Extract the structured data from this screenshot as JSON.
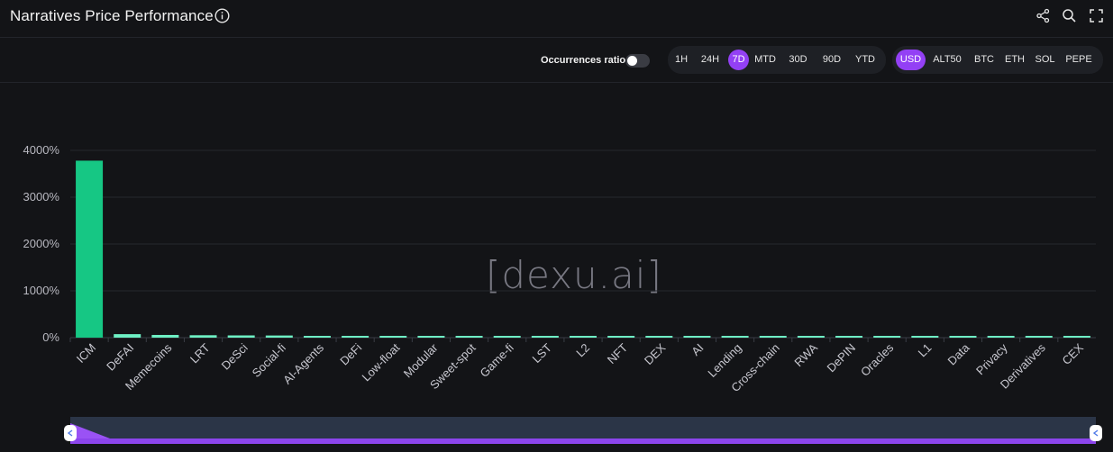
{
  "header": {
    "title": "Narratives Price Performance"
  },
  "controls": {
    "occurrences_label": "Occurrences ratio",
    "occurrences_on": false,
    "timeframes": [
      "1H",
      "24H",
      "7D",
      "MTD",
      "30D",
      "90D",
      "YTD"
    ],
    "active_timeframe": "7D",
    "currencies": [
      "USD",
      "ALT50",
      "BTC",
      "ETH",
      "SOL",
      "PEPE"
    ],
    "active_currency": "USD"
  },
  "watermark": "[dexu.ai]",
  "colors": {
    "accent": "#9340f5",
    "bar_primary": "#16c784",
    "bar_minor": "#6ef0c4",
    "background": "#131417"
  },
  "chart_data": {
    "type": "bar",
    "categories": [
      "ICM",
      "DeFAI",
      "Memecoins",
      "LRT",
      "DeSci",
      "Social-fi",
      "AI-Agents",
      "DeFi",
      "Low-float",
      "Modular",
      "Sweet-spot",
      "Game-fi",
      "LST",
      "L2",
      "NFT",
      "DEX",
      "AI",
      "Lending",
      "Cross-chain",
      "RWA",
      "DePIN",
      "Oracles",
      "L1",
      "Data",
      "Privacy",
      "Derivatives",
      "CEX"
    ],
    "values": [
      3780,
      75,
      58,
      52,
      48,
      46,
      36,
      32,
      28,
      26,
      24,
      22,
      20,
      19,
      18,
      17,
      16,
      15,
      14,
      13,
      12,
      11,
      10,
      9,
      8,
      7,
      6
    ],
    "ylim": [
      0,
      4000
    ],
    "yticks": [
      0,
      1000,
      2000,
      3000,
      4000
    ],
    "ytick_labels": [
      "0%",
      "1000%",
      "2000%",
      "3000%",
      "4000%"
    ],
    "title": "",
    "xlabel": "",
    "ylabel": "",
    "grid": true
  }
}
